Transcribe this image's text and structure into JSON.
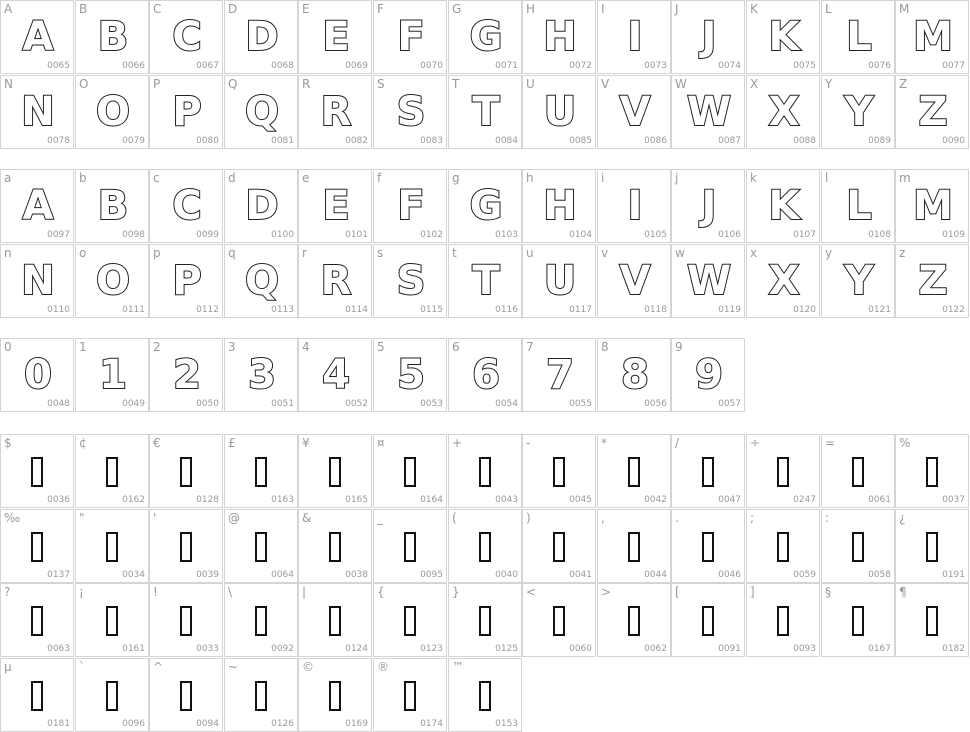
{
  "sections": [
    {
      "id": "upper",
      "kind": "glyph",
      "cells": [
        {
          "char": "A",
          "code": "0065"
        },
        {
          "char": "B",
          "code": "0066"
        },
        {
          "char": "C",
          "code": "0067"
        },
        {
          "char": "D",
          "code": "0068"
        },
        {
          "char": "E",
          "code": "0069"
        },
        {
          "char": "F",
          "code": "0070"
        },
        {
          "char": "G",
          "code": "0071"
        },
        {
          "char": "H",
          "code": "0072"
        },
        {
          "char": "I",
          "code": "0073"
        },
        {
          "char": "J",
          "code": "0074"
        },
        {
          "char": "K",
          "code": "0075"
        },
        {
          "char": "L",
          "code": "0076"
        },
        {
          "char": "M",
          "code": "0077"
        },
        {
          "char": "N",
          "code": "0078"
        },
        {
          "char": "O",
          "code": "0079"
        },
        {
          "char": "P",
          "code": "0080"
        },
        {
          "char": "Q",
          "code": "0081"
        },
        {
          "char": "R",
          "code": "0082"
        },
        {
          "char": "S",
          "code": "0083"
        },
        {
          "char": "T",
          "code": "0084"
        },
        {
          "char": "U",
          "code": "0085"
        },
        {
          "char": "V",
          "code": "0086"
        },
        {
          "char": "W",
          "code": "0087"
        },
        {
          "char": "X",
          "code": "0088"
        },
        {
          "char": "Y",
          "code": "0089"
        },
        {
          "char": "Z",
          "code": "0090"
        }
      ]
    },
    {
      "id": "lower",
      "kind": "glyph",
      "cells": [
        {
          "char": "a",
          "glyph": "A",
          "code": "0097"
        },
        {
          "char": "b",
          "glyph": "B",
          "code": "0098"
        },
        {
          "char": "c",
          "glyph": "C",
          "code": "0099"
        },
        {
          "char": "d",
          "glyph": "D",
          "code": "0100"
        },
        {
          "char": "e",
          "glyph": "E",
          "code": "0101"
        },
        {
          "char": "f",
          "glyph": "F",
          "code": "0102"
        },
        {
          "char": "g",
          "glyph": "G",
          "code": "0103"
        },
        {
          "char": "h",
          "glyph": "H",
          "code": "0104"
        },
        {
          "char": "i",
          "glyph": "I",
          "code": "0105"
        },
        {
          "char": "j",
          "glyph": "J",
          "code": "0106"
        },
        {
          "char": "k",
          "glyph": "K",
          "code": "0107"
        },
        {
          "char": "l",
          "glyph": "L",
          "code": "0108"
        },
        {
          "char": "m",
          "glyph": "M",
          "code": "0109"
        },
        {
          "char": "n",
          "glyph": "N",
          "code": "0110"
        },
        {
          "char": "o",
          "glyph": "O",
          "code": "0111"
        },
        {
          "char": "p",
          "glyph": "P",
          "code": "0112"
        },
        {
          "char": "q",
          "glyph": "Q",
          "code": "0113"
        },
        {
          "char": "r",
          "glyph": "R",
          "code": "0114"
        },
        {
          "char": "s",
          "glyph": "S",
          "code": "0115"
        },
        {
          "char": "t",
          "glyph": "T",
          "code": "0116"
        },
        {
          "char": "u",
          "glyph": "U",
          "code": "0117"
        },
        {
          "char": "v",
          "glyph": "V",
          "code": "0118"
        },
        {
          "char": "w",
          "glyph": "W",
          "code": "0119"
        },
        {
          "char": "x",
          "glyph": "X",
          "code": "0120"
        },
        {
          "char": "y",
          "glyph": "Y",
          "code": "0121"
        },
        {
          "char": "z",
          "glyph": "Z",
          "code": "0122"
        }
      ]
    },
    {
      "id": "digits",
      "kind": "glyph",
      "cells": [
        {
          "char": "0",
          "code": "0048"
        },
        {
          "char": "1",
          "code": "0049"
        },
        {
          "char": "2",
          "code": "0050"
        },
        {
          "char": "3",
          "code": "0051"
        },
        {
          "char": "4",
          "code": "0052"
        },
        {
          "char": "5",
          "code": "0053"
        },
        {
          "char": "6",
          "code": "0054"
        },
        {
          "char": "7",
          "code": "0055"
        },
        {
          "char": "8",
          "code": "0056"
        },
        {
          "char": "9",
          "code": "0057"
        }
      ]
    },
    {
      "id": "symbols",
      "kind": "missing",
      "cells": [
        {
          "char": "$",
          "code": "0036"
        },
        {
          "char": "¢",
          "code": "0162"
        },
        {
          "char": "€",
          "code": "0128"
        },
        {
          "char": "£",
          "code": "0163"
        },
        {
          "char": "¥",
          "code": "0165"
        },
        {
          "char": "¤",
          "code": "0164"
        },
        {
          "char": "+",
          "code": "0043"
        },
        {
          "char": "-",
          "code": "0045"
        },
        {
          "char": "*",
          "code": "0042"
        },
        {
          "char": "/",
          "code": "0047"
        },
        {
          "char": "÷",
          "code": "0247"
        },
        {
          "char": "=",
          "code": "0061"
        },
        {
          "char": "%",
          "code": "0037"
        },
        {
          "char": "‰",
          "code": "0137"
        },
        {
          "char": "\"",
          "code": "0034"
        },
        {
          "char": "'",
          "code": "0039"
        },
        {
          "char": "@",
          "code": "0064"
        },
        {
          "char": "&",
          "code": "0038"
        },
        {
          "char": "_",
          "code": "0095"
        },
        {
          "char": "(",
          "code": "0040"
        },
        {
          "char": ")",
          "code": "0041"
        },
        {
          "char": ",",
          "code": "0044"
        },
        {
          "char": ".",
          "code": "0046"
        },
        {
          "char": ";",
          "code": "0059"
        },
        {
          "char": ":",
          "code": "0058"
        },
        {
          "char": "¿",
          "code": "0191"
        },
        {
          "char": "?",
          "code": "0063"
        },
        {
          "char": "¡",
          "code": "0161"
        },
        {
          "char": "!",
          "code": "0033"
        },
        {
          "char": "\\",
          "code": "0092"
        },
        {
          "char": "|",
          "code": "0124"
        },
        {
          "char": "{",
          "code": "0123"
        },
        {
          "char": "}",
          "code": "0125"
        },
        {
          "char": "<",
          "code": "0060"
        },
        {
          "char": ">",
          "code": "0062"
        },
        {
          "char": "[",
          "code": "0091"
        },
        {
          "char": "]",
          "code": "0093"
        },
        {
          "char": "§",
          "code": "0167"
        },
        {
          "char": "¶",
          "code": "0182"
        },
        {
          "char": "µ",
          "code": "0181"
        },
        {
          "char": "`",
          "code": "0096"
        },
        {
          "char": "^",
          "code": "0094"
        },
        {
          "char": "~",
          "code": "0126"
        },
        {
          "char": "©",
          "code": "0169"
        },
        {
          "char": "®",
          "code": "0174"
        },
        {
          "char": "™",
          "code": "0153"
        }
      ]
    }
  ]
}
